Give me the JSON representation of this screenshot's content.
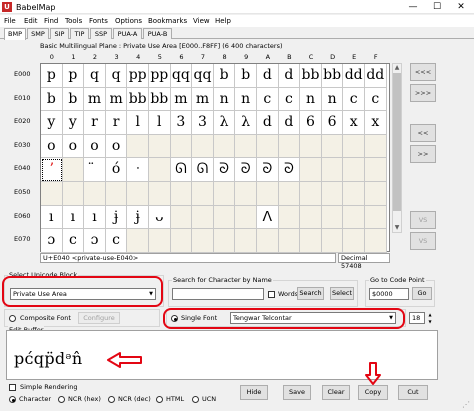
{
  "window": {
    "title": "BabelMap",
    "app_icon": "U",
    "controls": {
      "minimize": "—",
      "maximize": "☐",
      "close": "✕"
    }
  },
  "menu": [
    "File",
    "Edit",
    "Find",
    "Tools",
    "Fonts",
    "Options",
    "Bookmarks",
    "View",
    "Help"
  ],
  "tabs": [
    "BMP",
    "SMP",
    "SIP",
    "TIP",
    "SSP",
    "PUA-A",
    "PUA-B"
  ],
  "block_title": "Basic Multilingual Plane : Private Use Area [E000..F8FF] (6 400 characters)",
  "grid": {
    "col_headers": [
      "0",
      "1",
      "2",
      "3",
      "4",
      "5",
      "6",
      "7",
      "8",
      "9",
      "A",
      "B",
      "C",
      "D",
      "E",
      "F"
    ],
    "row_headers": [
      "E000",
      "E010",
      "E020",
      "E030",
      "E040",
      "E050",
      "E060",
      "E070"
    ],
    "rows": [
      [
        "p",
        "p",
        "q",
        "q",
        "pp",
        "pp",
        "qq",
        "qq",
        "b",
        "b",
        "d",
        "d",
        "bb",
        "bb",
        "dd",
        "dd"
      ],
      [
        "b",
        "b",
        "m",
        "m",
        "bb",
        "bb",
        "m",
        "m",
        "n",
        "n",
        "c",
        "c",
        "n",
        "n",
        "c",
        "c"
      ],
      [
        "y",
        "y",
        "r",
        "r",
        "l",
        "l",
        "3",
        "3",
        "λ",
        "λ",
        "d",
        "d",
        "6",
        "6",
        "x",
        "x"
      ],
      [
        "o",
        "o",
        "o",
        "o",
        "",
        "",
        "",
        "",
        "",
        "",
        "",
        "",
        "",
        "",
        "",
        ""
      ],
      [
        "ʼ",
        "",
        "̈",
        "ó",
        "ᐧ",
        "",
        "ᘏ",
        "ᘏ",
        "ᘐ",
        "ᘐ",
        "ᘐ",
        "ᘐ",
        "",
        "",
        "",
        ""
      ],
      [
        "",
        "",
        "",
        "",
        "",
        "",
        "",
        "",
        "",
        "",
        "",
        "",
        "",
        "",
        "",
        ""
      ],
      [
        "ı",
        "ı",
        "ı",
        "ɉ",
        "ɉ",
        "ᴗ",
        "",
        "",
        "",
        "",
        "ᐱ",
        "",
        "",
        "",
        "",
        ""
      ],
      [
        "ɔ",
        "c",
        "ɔ",
        "c",
        "",
        "",
        "",
        "",
        "",
        "",
        "",
        "",
        "",
        "",
        "",
        ""
      ]
    ]
  },
  "nav_buttons": [
    "<<<",
    ">>>",
    "<<",
    ">>",
    "VS",
    "VS"
  ],
  "char_info": "U+E040 <private-use-E040>",
  "decimal_info": "Decimal 57408",
  "unicode_block": {
    "label": "Select Unicode Block",
    "value": "Private Use Area"
  },
  "search": {
    "label": "Search for Character by Name",
    "value": "",
    "words_label": "Words",
    "search_button": "Search",
    "select_button": "Select"
  },
  "goto": {
    "label": "Go to Code Point",
    "value": "$0000",
    "go_button": "Go"
  },
  "font": {
    "composite_label": "Composite Font",
    "configure_button": "Configure",
    "single_label": "Single Font",
    "font_value": "Tengwar Telcontar",
    "size_value": "18"
  },
  "edit_buffer": {
    "label": "Edit Buffer",
    "text": "pᴄ́qp̈dᵊn̂"
  },
  "bottom": {
    "simple_rendering": "Simple Rendering",
    "radios": [
      "Character",
      "NCR (hex)",
      "NCR (dec)",
      "HTML",
      "UCN"
    ],
    "buttons": [
      "Hide",
      "Save",
      "Clear",
      "Copy",
      "Cut"
    ]
  },
  "colors": {
    "annotation_red": "#e30613",
    "cell_unassigned": "#f4f1e6"
  }
}
